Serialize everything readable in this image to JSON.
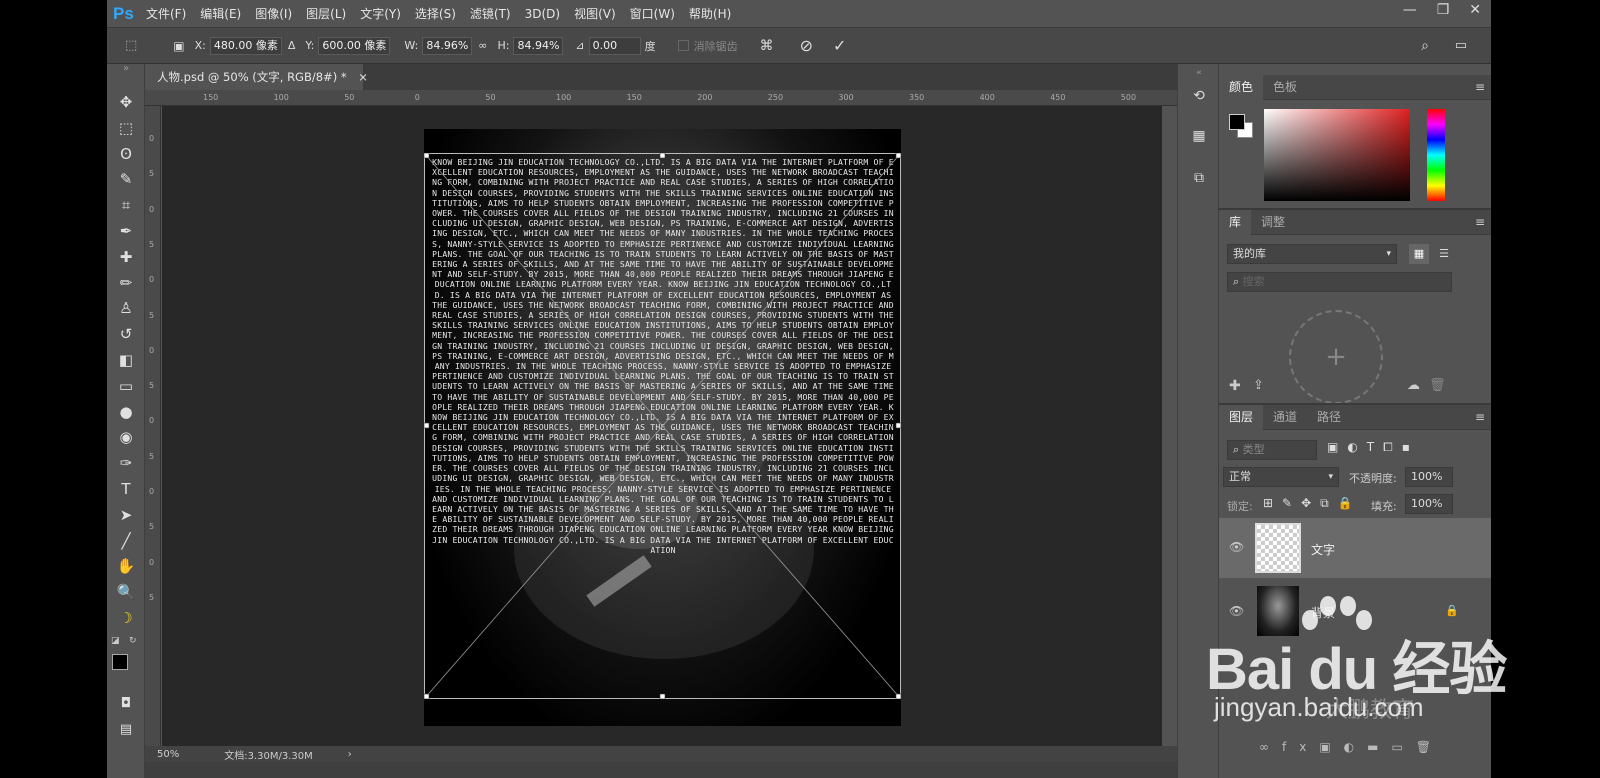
{
  "app": {
    "logo": "Ps"
  },
  "menu": [
    "文件(F)",
    "编辑(E)",
    "图像(I)",
    "图层(L)",
    "文字(Y)",
    "选择(S)",
    "滤镜(T)",
    "3D(D)",
    "视图(V)",
    "窗口(W)",
    "帮助(H)"
  ],
  "window_controls": {
    "minimize": "—",
    "restore": "❐",
    "close": "✕"
  },
  "options": {
    "x_label": "X:",
    "x_value": "480.00 像素",
    "delta": "Δ",
    "y_label": "Y:",
    "y_value": "600.00 像素",
    "w_label": "W:",
    "w_value": "84.96%",
    "link": "∞",
    "h_label": "H:",
    "h_value": "84.94%",
    "angle_symbol": "⊿",
    "angle_value": "0.00",
    "angle_unit": "度",
    "interp_label": "消除锯齿",
    "cancel": "⊘",
    "commit": "✓"
  },
  "document": {
    "tab_title": "人物.psd @ 50% (文字, RGB/8#) *",
    "tab_close": "×",
    "ruler_h": [
      "150",
      "100",
      "50",
      "0",
      "50",
      "100",
      "150",
      "200",
      "250",
      "300",
      "350",
      "400",
      "450",
      "500"
    ],
    "ruler_v": [
      "0",
      "5",
      "0",
      "5",
      "0",
      "5",
      "0",
      "5",
      "0",
      "5",
      "0",
      "5",
      "0",
      "5"
    ],
    "zoom": "50%",
    "doc_info": "文档:3.30M/3.30M",
    "status_arrow": "›"
  },
  "artwork": {
    "text": "KNOW BEIJING JIN EDUCATION TECHNOLOGY CO.,LTD. IS A BIG DATA VIA THE INTERNET PLATFORM OF EXCELLENT EDUCATION RESOURCES, EMPLOYMENT AS THE GUIDANCE, USES THE NETWORK BROADCAST TEACHING FORM, COMBINING WITH PROJECT PRACTICE AND REAL CASE STUDIES, A SERIES OF HIGH CORRELATION DESIGN COURSES, PROVIDING STUDENTS WITH THE SKILLS TRAINING SERVICES ONLINE EDUCATION INSTITUTIONS, AIMS TO HELP STUDENTS OBTAIN EMPLOYMENT, INCREASING THE PROFESSION COMPETITIVE POWER. THE COURSES COVER ALL FIELDS OF THE DESIGN TRAINING INDUSTRY, INCLUDING 21 COURSES INCLUDING UI DESIGN, GRAPHIC DESIGN, WEB DESIGN, PS TRAINING, E-COMMERCE ART DESIGN, ADVERTISING DESIGN, ETC., WHICH CAN MEET THE NEEDS OF MANY INDUSTRIES. IN THE WHOLE TEACHING PROCESS, NANNY-STYLE SERVICE IS ADOPTED TO EMPHASIZE PERTINENCE AND CUSTOMIZE INDIVIDUAL LEARNING PLANS. THE GOAL OF OUR TEACHING IS TO TRAIN STUDENTS TO LEARN ACTIVELY ON THE BASIS OF MASTERING A SERIES OF SKILLS, AND AT THE SAME TIME TO HAVE THE ABILITY OF SUSTAINABLE DEVELOPMENT AND SELF-STUDY. BY 2015, MORE THAN 40,000 PEOPLE REALIZED THEIR DREAMS THROUGH JIAPENG EDUCATION ONLINE LEARNING PLATFORM EVERY YEAR. KNOW BEIJING JIN EDUCATION TECHNOLOGY CO.,LTD. IS A BIG DATA VIA THE INTERNET PLATFORM OF EXCELLENT EDUCATION RESOURCES, EMPLOYMENT AS THE GUIDANCE, USES THE NETWORK BROADCAST TEACHING FORM, COMBINING WITH PROJECT PRACTICE AND REAL CASE STUDIES, A SERIES OF HIGH CORRELATION DESIGN COURSES, PROVIDING STUDENTS WITH THE SKILLS TRAINING SERVICES ONLINE EDUCATION INSTITUTIONS, AIMS TO HELP STUDENTS OBTAIN EMPLOYMENT, INCREASING THE PROFESSION COMPETITIVE POWER. THE COURSES COVER ALL FIELDS OF THE DESIGN TRAINING INDUSTRY, INCLUDING 21 COURSES INCLUDING UI DESIGN, GRAPHIC DESIGN, WEB DESIGN, PS TRAINING, E-COMMERCE ART DESIGN, ADVERTISING DESIGN, ETC., WHICH CAN MEET THE NEEDS OF MANY INDUSTRIES. IN THE WHOLE TEACHING PROCESS, NANNY-STYLE SERVICE IS ADOPTED TO EMPHASIZE PERTINENCE AND CUSTOMIZE INDIVIDUAL LEARNING PLANS. THE GOAL OF OUR TEACHING IS TO TRAIN STUDENTS TO LEARN ACTIVELY ON THE BASIS OF MASTERING A SERIES OF SKILLS, AND AT THE SAME TIME TO HAVE THE ABILITY OF SUSTAINABLE DEVELOPMENT AND SELF-STUDY. BY 2015, MORE THAN 40,000 PEOPLE REALIZED THEIR DREAMS THROUGH JIAPENG EDUCATION ONLINE LEARNING PLATFORM EVERY YEAR. KNOW BEIJING JIN EDUCATION TECHNOLOGY CO.,LTD. IS A BIG DATA VIA THE INTERNET PLATFORM OF EXCELLENT EDUCATION RESOURCES, EMPLOYMENT AS THE GUIDANCE, USES THE NETWORK BROADCAST TEACHING FORM, COMBINING WITH PROJECT PRACTICE AND REAL CASE STUDIES, A SERIES OF HIGH CORRELATION DESIGN COURSES, PROVIDING STUDENTS WITH THE SKILLS TRAINING SERVICES ONLINE EDUCATION INSTITUTIONS, AIMS TO HELP STUDENTS OBTAIN EMPLOYMENT, INCREASING THE PROFESSION COMPETITIVE POWER. THE COURSES COVER ALL FIELDS OF THE DESIGN TRAINING INDUSTRY, INCLUDING 21 COURSES INCLUDING UI DESIGN, GRAPHIC DESIGN, WEB DESIGN, ETC., WHICH CAN MEET THE NEEDS OF MANY INDUSTRIES. IN THE WHOLE TEACHING PROCESS, NANNY-STYLE SERVICE IS ADOPTED TO EMPHASIZE PERTINENCE AND CUSTOMIZE INDIVIDUAL LEARNING PLANS. THE GOAL OF OUR TEACHING IS TO TRAIN STUDENTS TO LEARN ACTIVELY ON THE BASIS OF MASTERING A SERIES OF SKILLS, AND AT THE SAME TIME TO HAVE THE ABILITY OF SUSTAINABLE DEVELOPMENT AND SELF-STUDY. BY 2015, MORE THAN 40,000 PEOPLE REALIZED THEIR DREAMS THROUGH JIAPENG EDUCATION ONLINE LEARNING PLATFORM EVERY YEAR KNOW BEIJING JIN EDUCATION TECHNOLOGY CO.,LTD. IS A BIG DATA VIA THE INTERNET PLATFORM OF EXCELLENT EDUCATION"
  },
  "tools": [
    {
      "name": "move-tool-icon",
      "glyph": "✥"
    },
    {
      "name": "marquee-tool-icon",
      "glyph": "⬚"
    },
    {
      "name": "lasso-tool-icon",
      "glyph": "ʘ"
    },
    {
      "name": "quick-select-tool-icon",
      "glyph": "✎"
    },
    {
      "name": "crop-tool-icon",
      "glyph": "⌗"
    },
    {
      "name": "eyedropper-tool-icon",
      "glyph": "✒"
    },
    {
      "name": "healing-brush-tool-icon",
      "glyph": "✚"
    },
    {
      "name": "brush-tool-icon",
      "glyph": "✏"
    },
    {
      "name": "stamp-tool-icon",
      "glyph": "♙"
    },
    {
      "name": "history-brush-tool-icon",
      "glyph": "↺"
    },
    {
      "name": "eraser-tool-icon",
      "glyph": "◧"
    },
    {
      "name": "gradient-tool-icon",
      "glyph": "▭"
    },
    {
      "name": "blur-tool-icon",
      "glyph": "●"
    },
    {
      "name": "dodge-tool-icon",
      "glyph": "◉"
    },
    {
      "name": "pen-tool-icon",
      "glyph": "✑"
    },
    {
      "name": "type-tool-icon",
      "glyph": "T"
    },
    {
      "name": "path-select-tool-icon",
      "glyph": "➤"
    },
    {
      "name": "line-tool-icon",
      "glyph": "╱"
    },
    {
      "name": "hand-tool-icon",
      "glyph": "✋"
    },
    {
      "name": "zoom-tool-icon",
      "glyph": "🔍"
    },
    {
      "name": "banana-tool-icon",
      "glyph": "☽"
    }
  ],
  "panels": {
    "color_tabs": [
      "颜色",
      "色板"
    ],
    "library_tabs": [
      "库",
      "调整"
    ],
    "library_select": "我的库",
    "library_search_placeholder": "搜索",
    "layers_tabs": [
      "图层",
      "通道",
      "路径"
    ],
    "layer_filter": "类型",
    "blend_mode": "正常",
    "opacity_label": "不透明度:",
    "opacity_value": "100%",
    "lock_label": "锁定:",
    "fill_label": "填充:",
    "fill_value": "100%",
    "layers": [
      {
        "name": "文字",
        "visible": true,
        "selected": true
      },
      {
        "name": "背景",
        "visible": true,
        "selected": false
      }
    ],
    "menu_glyph": "≡"
  },
  "watermark": {
    "word": "Bai du 经验",
    "url": "jingyan.baidu.com",
    "sub": "大鹏教育"
  },
  "colors": {
    "foreground": "#000000",
    "background": "#ffffff",
    "ui_bg": "#535353",
    "canvas_bg": "#282828"
  }
}
